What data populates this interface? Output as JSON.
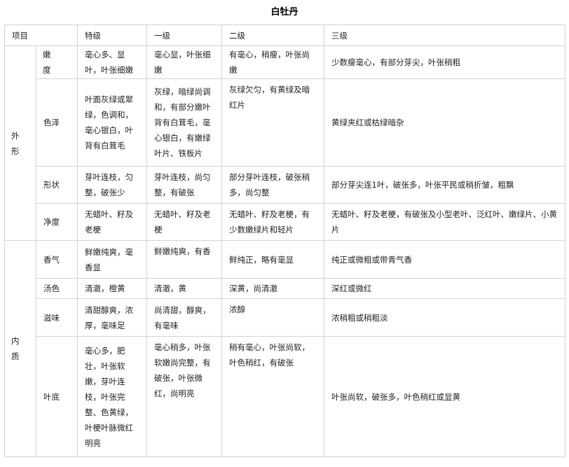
{
  "title": "白牡丹",
  "header": {
    "item": "项目",
    "special": "特级",
    "grade1": "一级",
    "grade2": "二级",
    "grade3": "三级"
  },
  "groups": {
    "appearance_char1": "外",
    "appearance_char2": "形",
    "internal_char1": "内",
    "internal_char2": "质"
  },
  "rows": {
    "tenderness": {
      "label_char1": "嫩",
      "label_char2": "度",
      "special": "毫心多、显叶，叶张细嫩",
      "grade1": "毫心显，叶张细嫩",
      "grade2": "有毫心，稍瘦，叶张尚嫩",
      "grade3": "少数瘦毫心，有部分芽尖，叶张稍粗"
    },
    "color": {
      "label": "色泽",
      "special": "叶面灰绿或翠绿，色调和，毫心银白，叶背有白茸毛",
      "grade1": "灰绿，暗绿尚调和，有部分嫩叶背有白茸毛，毫心银白，有嫩绿叶片、铁板片",
      "grade2": "灰绿欠匀，有黄绿及暗红片",
      "grade3": "黄绿夹红或枯绿暗杂"
    },
    "shape": {
      "label": "形状",
      "special": "芽叶连枝，匀整，破张少",
      "grade1": "芽叶连枝，尚匀整，有破张",
      "grade2": "部分芽叶连枝，破张稍多，尚匀整",
      "grade3": "部分芽尖连1叶，破张多，叶张平民或稍折皱，粗飘"
    },
    "cleanliness": {
      "label": "净度",
      "special": "无蜡叶、籽及老梗",
      "grade1": "无蜡叶、籽及老梗",
      "grade2": "无蜡叶、籽及老梗，有少数嫩绿片和轻片",
      "grade3": "无蜡叶、籽及老梗，有破张及小型老叶、泛红叶、嫩绿片、小黄片"
    },
    "aroma": {
      "label": "香气",
      "special": "鲜嫩纯爽，毫香显",
      "grade1": "鲜嫩纯爽，有香",
      "grade2": "鲜纯正，略有毫显",
      "grade3": "纯正或微粗或带青气香"
    },
    "liquor": {
      "label": "汤色",
      "special": "清澈，橙黄",
      "grade1": "清澈，黄",
      "grade2": "深黄，尚清澈",
      "grade3": "深红或微红"
    },
    "taste": {
      "label": "滋味",
      "special": "清甜醇爽，浓厚，毫味足",
      "grade1": "尚清甜，醇爽，有毫味",
      "grade2": "浓醇",
      "grade3": "浓稍粗或稍粗淡"
    },
    "leaf_base": {
      "label": "叶底",
      "special": "毫心多，肥壮，叶张软嫩，芽叶连枝，叶张完整、色黄绿，叶梗叶脉微红明亮",
      "grade1": "毫心稍多，叶张软嫩尚完整，有破张，叶张微红，尚明亮",
      "grade2": "稍有毫心，叶张尚软，叶色稍红，有破张",
      "grade3": "叶张尚软，破张多，叶色稍红或显黄"
    }
  }
}
